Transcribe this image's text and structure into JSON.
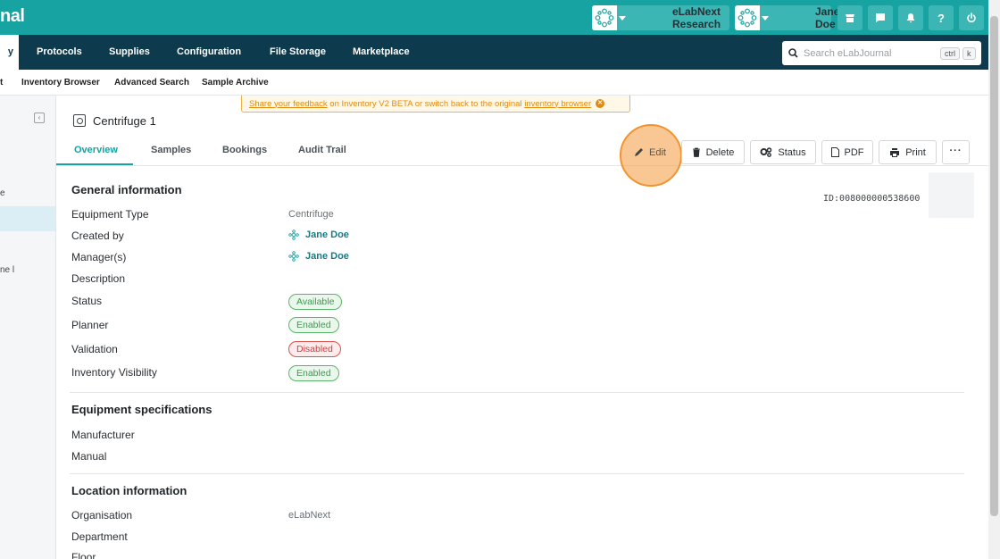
{
  "app": {
    "brand_partial": "nal"
  },
  "topbar": {
    "workspace_label": "eLabNext Research",
    "user_label": "Jane Doe"
  },
  "nav": {
    "items": [
      "y",
      "Protocols",
      "Supplies",
      "Configuration",
      "File Storage",
      "Marketplace"
    ]
  },
  "search": {
    "placeholder": "Search eLabJournal",
    "kbd1": "ctrl",
    "kbd2": "k"
  },
  "subnav": {
    "items": [
      "t",
      "Inventory Browser",
      "Advanced Search",
      "Sample Archive"
    ]
  },
  "sidebar": {
    "fragments": [
      "e",
      "ne l"
    ]
  },
  "banner": {
    "link1": "Share your feedback",
    "middle": " on Inventory V2 BETA or switch back to the original ",
    "link2": "inventory browser"
  },
  "item": {
    "title": "Centrifuge 1",
    "id_text": "ID:008000000538600"
  },
  "tabs": [
    "Overview",
    "Samples",
    "Bookings",
    "Audit Trail"
  ],
  "actions": {
    "edit": "Edit",
    "delete": "Delete",
    "status": "Status",
    "pdf": "PDF",
    "print": "Print"
  },
  "general": {
    "heading": "General information",
    "fields": {
      "equipment_type_label": "Equipment Type",
      "equipment_type_value": "Centrifuge",
      "created_by_label": "Created by",
      "created_by_value": "Jane Doe",
      "managers_label": "Manager(s)",
      "managers_value": "Jane Doe",
      "description_label": "Description",
      "status_label": "Status",
      "status_value": "Available",
      "planner_label": "Planner",
      "planner_value": "Enabled",
      "validation_label": "Validation",
      "validation_value": "Disabled",
      "visibility_label": "Inventory Visibility",
      "visibility_value": "Enabled"
    }
  },
  "specs": {
    "heading": "Equipment specifications",
    "manufacturer_label": "Manufacturer",
    "manual_label": "Manual"
  },
  "location": {
    "heading": "Location information",
    "organisation_label": "Organisation",
    "organisation_value": "eLabNext",
    "department_label": "Department",
    "floor_label": "Floor"
  },
  "colors": {
    "teal": "#17a3a1",
    "navy": "#0d3a4c",
    "orange": "#f2932e"
  }
}
